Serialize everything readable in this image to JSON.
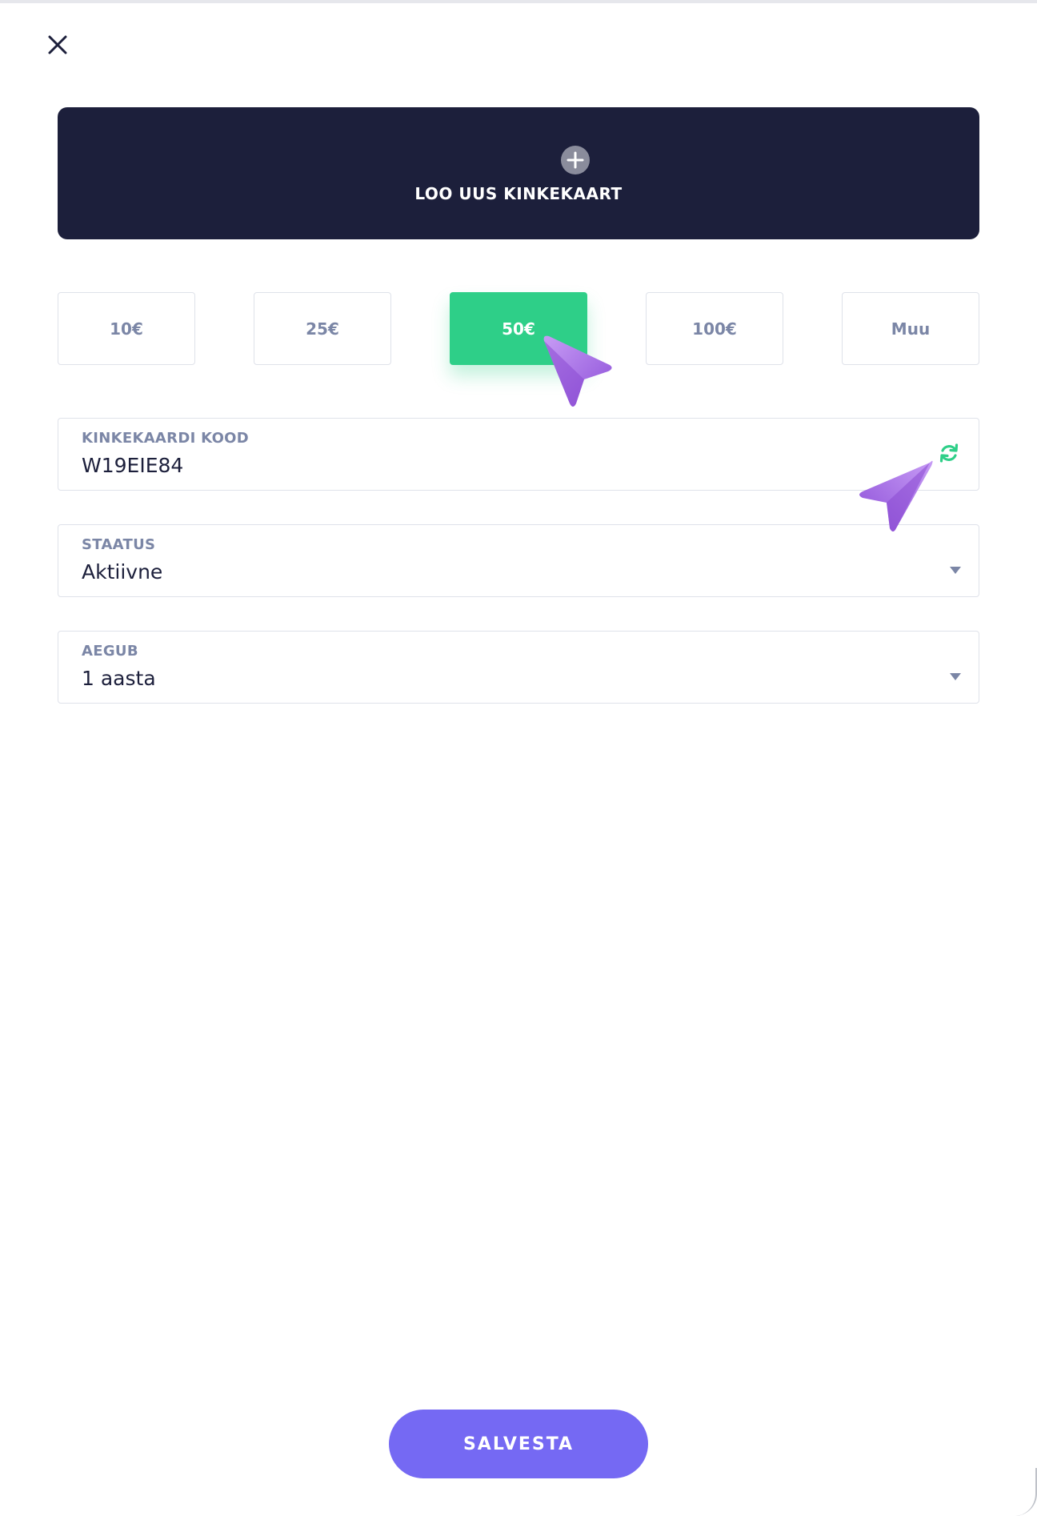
{
  "header": {
    "close_icon": "close-icon"
  },
  "create_card": {
    "icon": "plus-circle-icon",
    "title": "LOO UUS KINKEKAART"
  },
  "amount_options": [
    {
      "label": "10€",
      "selected": false
    },
    {
      "label": "25€",
      "selected": false
    },
    {
      "label": "50€",
      "selected": true
    },
    {
      "label": "100€",
      "selected": false
    },
    {
      "label": "Muu",
      "selected": false
    }
  ],
  "code_field": {
    "label": "KINKEKAARDI KOOD",
    "value": "W19EIE84",
    "icon": "refresh-icon"
  },
  "status_field": {
    "label": "STAATUS",
    "value": "Aktiivne",
    "icon": "dropdown-caret-icon"
  },
  "expires_field": {
    "label": "AEGUB",
    "value": "1 aasta",
    "icon": "dropdown-caret-icon"
  },
  "save_button": {
    "label": "SALVESTA"
  },
  "colors": {
    "dark_card": "#1c1f3b",
    "selected_green": "#2ecf88",
    "label_gray": "#7b86a6",
    "save_purple": "#7569f3",
    "cursor_purple": "#a66de8"
  }
}
